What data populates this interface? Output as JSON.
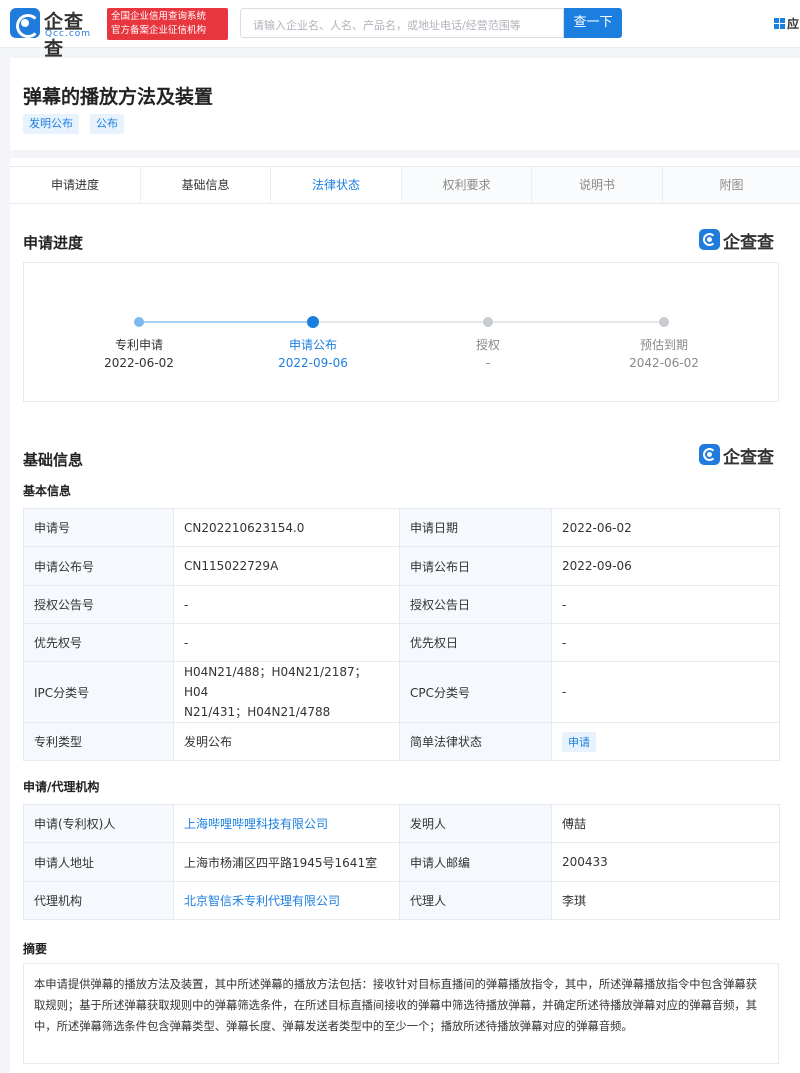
{
  "header": {
    "logo_text": "企查查",
    "logo_sub": "Qcc.com",
    "gov_badge_line1": "全国企业信用查询系统",
    "gov_badge_line2": "官方备案企业征信机构",
    "search_placeholder": "请输入企业名、人名、产品名，或地址电话/经营范围等",
    "search_button": "查一下",
    "right_label": "应"
  },
  "patent": {
    "title": "弹幕的播放方法及装置",
    "tags": [
      "发明公布",
      "公布"
    ]
  },
  "tabs": [
    "申请进度",
    "基础信息",
    "法律状态",
    "权利要求",
    "说明书",
    "附图"
  ],
  "watermark": "企查查",
  "progress": {
    "title": "申请进度",
    "steps": [
      {
        "label": "专利申请",
        "date": "2022-06-02"
      },
      {
        "label": "申请公布",
        "date": "2022-09-06"
      },
      {
        "label": "授权",
        "date": "-"
      },
      {
        "label": "预估到期",
        "date": "2042-06-02"
      }
    ]
  },
  "basic": {
    "title": "基础信息",
    "subtitle": "基本信息",
    "rows": [
      {
        "k1": "申请号",
        "v1": "CN202210623154.0",
        "k2": "申请日期",
        "v2": "2022-06-02"
      },
      {
        "k1": "申请公布号",
        "v1": "CN115022729A",
        "k2": "申请公布日",
        "v2": "2022-09-06"
      },
      {
        "k1": "授权公告号",
        "v1": "-",
        "k2": "授权公告日",
        "v2": "-"
      },
      {
        "k1": "优先权号",
        "v1": "-",
        "k2": "优先权日",
        "v2": "-"
      },
      {
        "k1": "IPC分类号",
        "v1a": "H04N21/488；H04N21/2187；H04",
        "v1b": "N21/431；H04N21/4788",
        "k2": "CPC分类号",
        "v2": "-"
      },
      {
        "k1": "专利类型",
        "v1": "发明公布",
        "k2": "简单法律状态",
        "v2": "申请"
      }
    ]
  },
  "agency": {
    "subtitle": "申请/代理机构",
    "rows": [
      {
        "k1": "申请(专利权)人",
        "v1": "上海哔哩哔哩科技有限公司",
        "k2": "发明人",
        "v2": "傅喆"
      },
      {
        "k1": "申请人地址",
        "v1": "上海市杨浦区四平路1945号1641室",
        "k2": "申请人邮编",
        "v2": "200433"
      },
      {
        "k1": "代理机构",
        "v1": "北京智信禾专利代理有限公司",
        "k2": "代理人",
        "v2": "李琪"
      }
    ]
  },
  "abstract": {
    "subtitle": "摘要",
    "text": "本申请提供弹幕的播放方法及装置，其中所述弹幕的播放方法包括：接收针对目标直播间的弹幕播放指令，其中，所述弹幕播放指令中包含弹幕获取规则；基于所述弹幕获取规则中的弹幕筛选条件，在所述目标直播间接收的弹幕中筛选待播放弹幕，并确定所述待播放弹幕对应的弹幕音频，其中，所述弹幕筛选条件包含弹幕类型、弹幕长度、弹幕发送者类型中的至少一个；播放所述待播放弹幕对应的弹幕音频。"
  },
  "colors": {
    "accent": "#1c7fe0",
    "done_dot": "#7db8ee",
    "pending_dot": "#c8cbd0",
    "badge_red": "#e8363f"
  }
}
